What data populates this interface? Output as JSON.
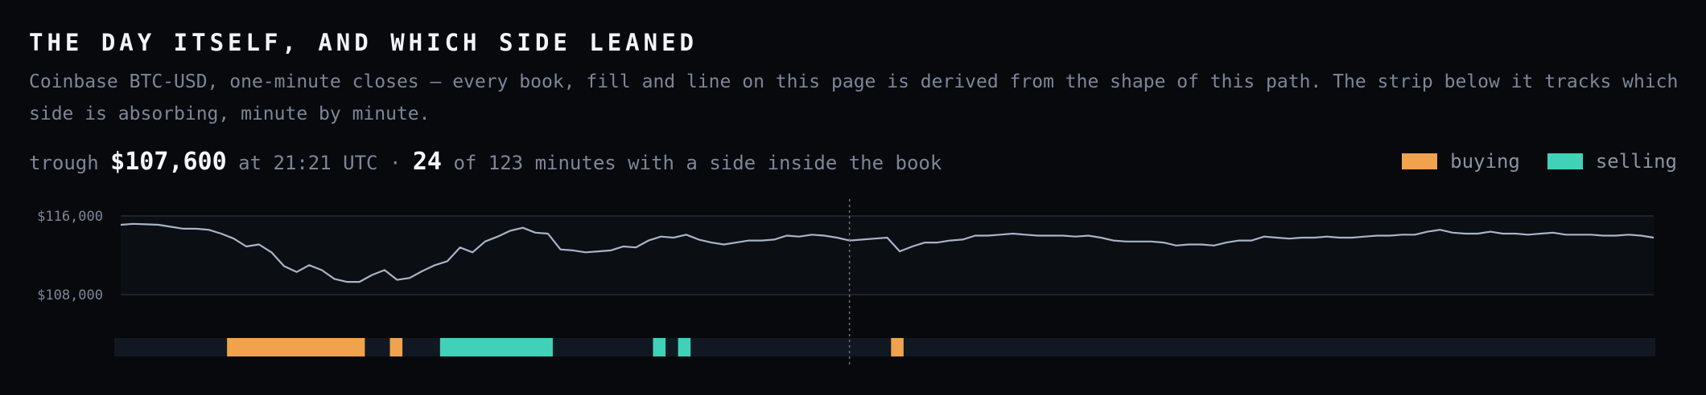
{
  "header": {
    "title": "THE DAY ITSELF, AND WHICH SIDE LEANED",
    "subtitle": "Coinbase BTC-USD, one-minute closes — every book, fill and line on this page is derived from the shape of this path. The strip below it tracks which side is absorbing, minute by minute."
  },
  "stats": {
    "trough_label": "trough",
    "trough_value": "$107,600",
    "trough_time": "at 21:21 UTC ·",
    "inside_count": "24",
    "inside_text": "of 123 minutes with a side inside the book"
  },
  "legend": {
    "buying": "buying",
    "selling": "selling"
  },
  "colors": {
    "buying": "#f0a24c",
    "selling": "#3fd2b8",
    "line": "#a9b4c8",
    "strip_bg": "#121821",
    "grid": "#262b35"
  },
  "chart_data": {
    "type": "line",
    "title": "THE DAY ITSELF, AND WHICH SIDE LEANED",
    "xlabel": "",
    "ylabel": "",
    "ylim": [
      107000,
      117000
    ],
    "yticks": [
      108000,
      116000
    ],
    "ytick_labels": [
      "$108,000",
      "$116,000"
    ],
    "minutes": 123,
    "marker_minute": 58,
    "series": [
      {
        "values": [
          115100,
          115200,
          115150,
          115100,
          114900,
          114700,
          114700,
          114600,
          114200,
          113700,
          112900,
          113100,
          112300,
          110900,
          110300,
          111000,
          110500,
          109600,
          109300,
          109300,
          110000,
          110500,
          109500,
          109700,
          110400,
          111000,
          111400,
          112800,
          112300,
          113400,
          113900,
          114500,
          114800,
          114300,
          114200,
          112600,
          112500,
          112300,
          112400,
          112500,
          112900,
          112800,
          113500,
          113900,
          113800,
          114100,
          113600,
          113300,
          113100,
          113300,
          113500,
          113500,
          113600,
          114000,
          113900,
          114100,
          114000,
          113800,
          113500,
          113600,
          113700,
          113800,
          112400,
          112900,
          113300,
          113300,
          113500,
          113600,
          114000,
          114000,
          114100,
          114200,
          114100,
          114000,
          114000,
          114000,
          113900,
          114000,
          113800,
          113500,
          113400,
          113400,
          113400,
          113300,
          113000,
          113100,
          113100,
          113000,
          113300,
          113500,
          113500,
          113900,
          113800,
          113700,
          113800,
          113800,
          113900,
          113800,
          113800,
          113900,
          114000,
          114000,
          114100,
          114100,
          114400,
          114600,
          114300,
          114200,
          114200,
          114400,
          114200,
          114200,
          114100,
          114200,
          114300,
          114100,
          114100,
          114100,
          114000,
          114000,
          114100,
          114000,
          113800
        ]
      }
    ],
    "strip": [
      {
        "side": "buying",
        "start": 9,
        "end": 20
      },
      {
        "side": "buying",
        "start": 22,
        "end": 23
      },
      {
        "side": "selling",
        "start": 26,
        "end": 35
      },
      {
        "side": "selling",
        "start": 43,
        "end": 44
      },
      {
        "side": "selling",
        "start": 45,
        "end": 46
      },
      {
        "side": "buying",
        "start": 62,
        "end": 63
      }
    ]
  }
}
